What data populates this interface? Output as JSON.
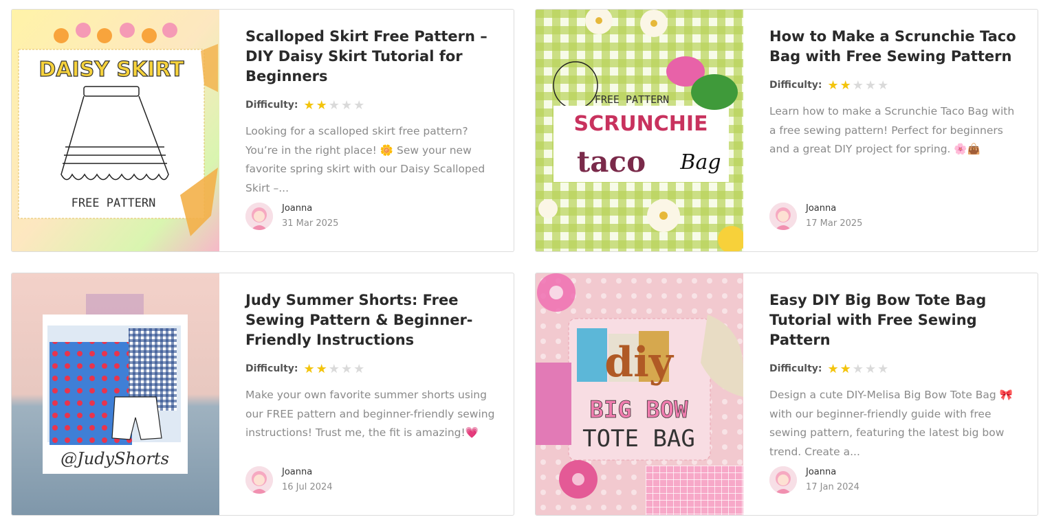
{
  "difficulty_label": "Difficulty:",
  "posts": [
    {
      "title": "Scalloped Skirt Free Pattern – DIY Daisy Skirt Tutorial for Beginners",
      "difficulty": 2,
      "excerpt": "Looking for a scalloped skirt free pattern? You’re in the right place! 🌼 Sew your new favorite spring skirt with our Daisy Scalloped Skirt –...",
      "author": "Joanna",
      "date": "31 Mar 2025",
      "image_text": {
        "heading": "DAISY SKIRT",
        "footer": "FREE PATTERN"
      }
    },
    {
      "title": "How to Make a Scrunchie Taco Bag with Free Sewing Pattern",
      "difficulty": 2,
      "excerpt": "Learn how to make a Scrunchie Taco Bag with a free sewing pattern! Perfect for beginners and a great DIY project for spring. 🌸👜",
      "author": "Joanna",
      "date": "17 Mar 2025",
      "image_text": {
        "top": "FREE PATTERN",
        "heading": "SCRUNCHIE",
        "word1": "taco",
        "word2": "Bag"
      }
    },
    {
      "title": "Judy Summer Shorts: Free Sewing Pattern & Beginner-Friendly Instructions",
      "difficulty": 2,
      "excerpt": "Make your own favorite summer shorts using our FREE pattern and beginner-friendly sewing instructions! Trust me, the fit is amazing!💗",
      "author": "Joanna",
      "date": "16 Jul 2024",
      "image_text": {
        "handle": "@JudyShorts"
      }
    },
    {
      "title": "Easy DIY Big Bow Tote Bag Tutorial with Free Sewing Pattern",
      "difficulty": 2,
      "excerpt": "Design a cute DIY-Melisa Big Bow Tote Bag 🎀 with our beginner-friendly guide with free sewing pattern, featuring the latest big bow trend. Create a...",
      "author": "Joanna",
      "date": "17 Jan 2024",
      "image_text": {
        "word": "diy",
        "line1": "BIG BOW",
        "line2": "TOTE BAG"
      }
    }
  ],
  "colors": {
    "star_on": "#f3c40d",
    "star_off": "#dadada",
    "title": "#2a2a2a",
    "excerpt": "#8a8a8a"
  }
}
